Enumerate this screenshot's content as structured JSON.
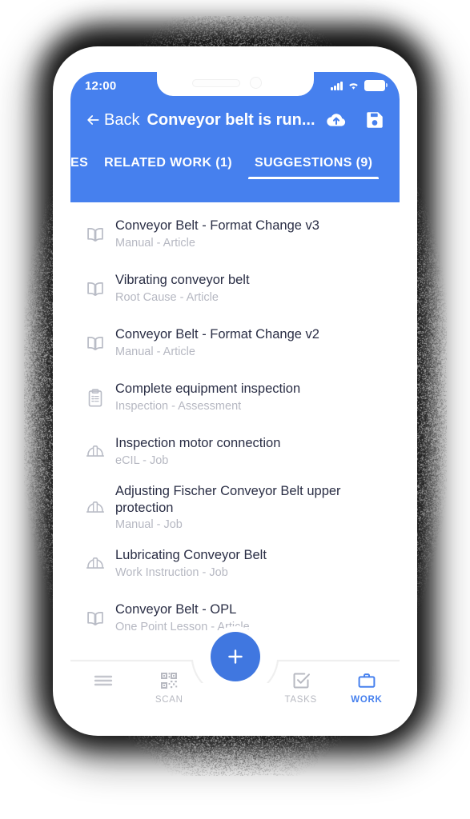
{
  "theme": {
    "header_blue": "#4680ee",
    "fab_blue": "#4077e0",
    "accent_blue": "#4680ee",
    "title_text": "#2a2e45",
    "subtitle_text": "#b6b8c2",
    "inactive_nav": "#b7b9c1"
  },
  "status_bar": {
    "time": "12:00",
    "signal_icon": "cellular-signal-icon",
    "wifi_icon": "wifi-icon",
    "battery_icon": "battery-icon"
  },
  "header": {
    "back_label": "Back",
    "back_icon": "arrow-left-icon",
    "title": "Conveyor belt is run...",
    "actions": [
      {
        "name": "cloud-upload-button",
        "icon": "cloud-upload-icon"
      },
      {
        "name": "save-button",
        "icon": "save-floppy-icon"
      }
    ]
  },
  "tabs": [
    {
      "label": "ES",
      "active": false,
      "partial": true
    },
    {
      "label": "RELATED WORK (1)",
      "active": false,
      "partial": false
    },
    {
      "label": "SUGGESTIONS (9)",
      "active": true,
      "partial": false
    }
  ],
  "suggestions": [
    {
      "title": "Conveyor Belt - Format Change v3",
      "subtitle": "Manual - Article",
      "icon": "book-icon"
    },
    {
      "title": "Vibrating conveyor belt",
      "subtitle": "Root Cause - Article",
      "icon": "book-icon"
    },
    {
      "title": "Conveyor Belt - Format Change v2",
      "subtitle": "Manual - Article",
      "icon": "book-icon"
    },
    {
      "title": "Complete equipment inspection",
      "subtitle": "Inspection - Assessment",
      "icon": "clipboard-checklist-icon"
    },
    {
      "title": "Inspection motor connection",
      "subtitle": "eCIL - Job",
      "icon": "hard-hat-icon"
    },
    {
      "title": "Adjusting Fischer Conveyor Belt upper protection",
      "subtitle": "Manual - Job",
      "icon": "hard-hat-icon"
    },
    {
      "title": "Lubricating Conveyor Belt",
      "subtitle": "Work Instruction - Job",
      "icon": "hard-hat-icon"
    },
    {
      "title": "Conveyor Belt - OPL",
      "subtitle": "One Point Lesson - Article",
      "icon": "book-icon"
    }
  ],
  "bottom_nav": {
    "fab": {
      "label": "+",
      "icon": "plus-icon"
    },
    "items": [
      {
        "label": "",
        "icon": "hamburger-menu-icon",
        "name": "nav-menu",
        "active": false
      },
      {
        "label": "SCAN",
        "icon": "qr-code-icon",
        "name": "nav-scan",
        "active": false
      },
      {
        "label": "TASKS",
        "icon": "checkbox-check-icon",
        "name": "nav-tasks",
        "active": false
      },
      {
        "label": "WORK",
        "icon": "briefcase-icon",
        "name": "nav-work",
        "active": true
      }
    ]
  }
}
